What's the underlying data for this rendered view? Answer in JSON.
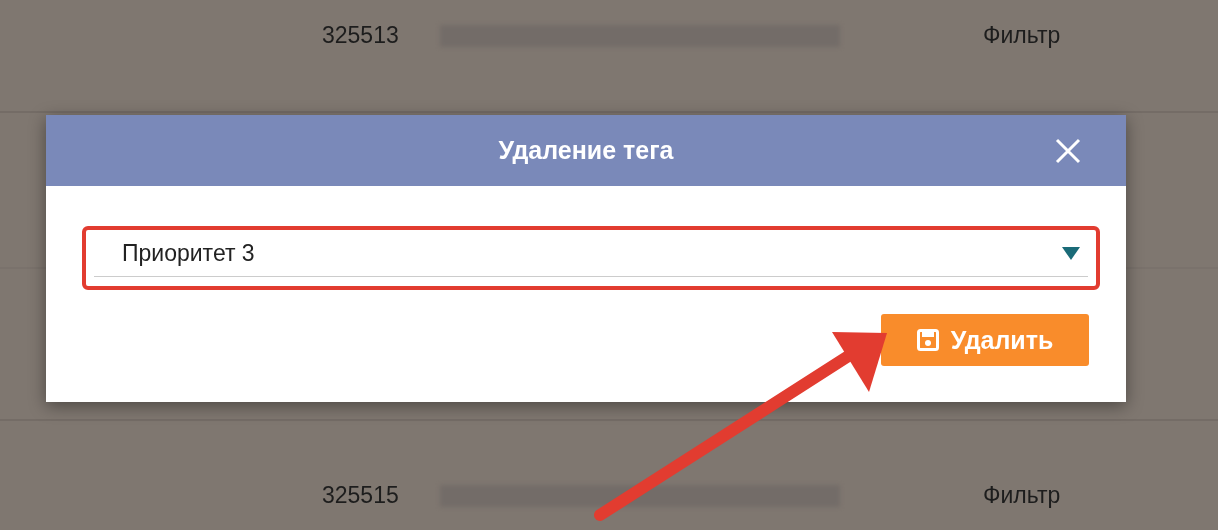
{
  "background_rows": [
    {
      "id": "325513",
      "column_3": "Фильтр"
    },
    {
      "id": "325515",
      "column_3": "Фильтр"
    }
  ],
  "dialog": {
    "title": "Удаление тега",
    "select": {
      "value": "Приоритет 3"
    },
    "button": "Удалить"
  }
}
